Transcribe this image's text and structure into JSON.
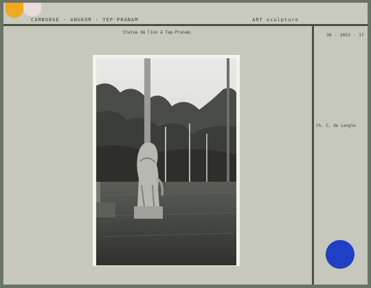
{
  "header": {
    "location": "CAMBODGE - ANGKOR - TEP-PRANAM",
    "subject": "ART  sculpture"
  },
  "caption": "Statue de lion à Tep-Pranam.",
  "reference": "30 - 2053 - 17",
  "credit": "Ch. C. de Langle",
  "colors": {
    "card": "#c6c8bb",
    "rule": "#4a4f47",
    "tab_orange": "#f0a81c",
    "tab_pink": "#e9dadb",
    "stamp_blue": "#1f3fc4"
  }
}
